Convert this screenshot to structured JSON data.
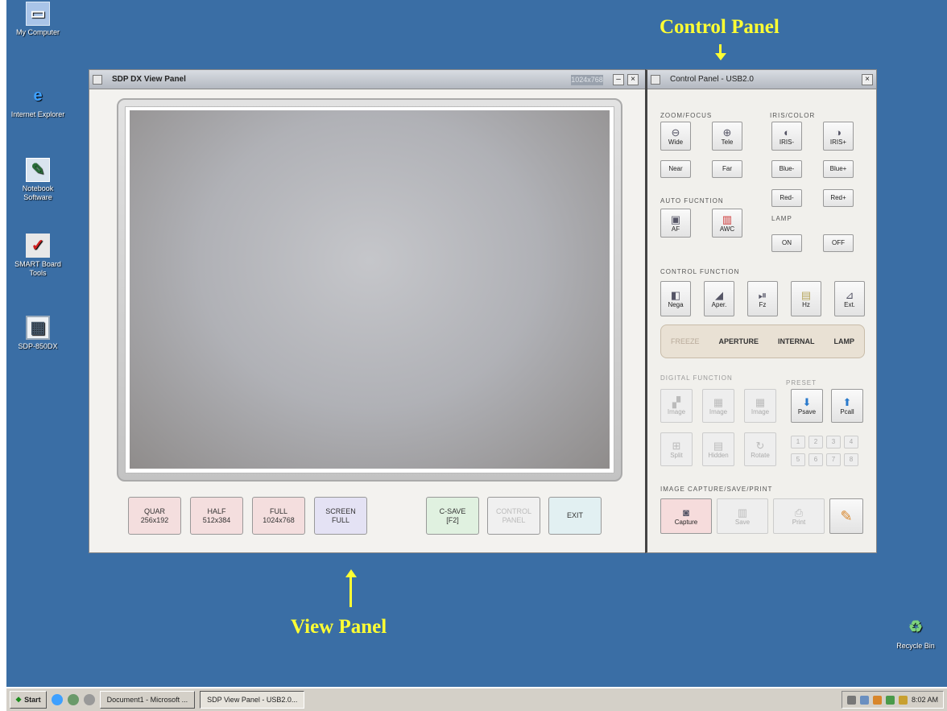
{
  "desktop": {
    "icons": [
      "My Computer",
      "Internet Explorer",
      "Notebook Software",
      "SMART Board Tools",
      "SDP-850DX",
      "Recycle Bin"
    ],
    "labels": {
      "control_panel": "Control Panel",
      "view_panel": "View Panel"
    }
  },
  "view_panel": {
    "title": "SDP DX View Panel",
    "resolution_badge": "1024x768",
    "buttons": {
      "quar": "QUAR\n256x192",
      "half": "HALF\n512x384",
      "full": "FULL\n1024x768",
      "screen_full": "SCREEN\nFULL",
      "csave": "C-SAVE\n[F2]",
      "control_panel": "CONTROL\nPANEL",
      "exit": "EXIT"
    }
  },
  "control_panel": {
    "title": "Control Panel - USB2.0",
    "sections": {
      "zoom_focus": "ZOOM/FOCUS",
      "iris_color": "IRIS/COLOR",
      "auto_function": "AUTO FUCNTION",
      "lamp": "LAMP",
      "control_function": "CONTROL FUNCTION",
      "digital_function": "DIGITAL FUNCTION",
      "preset": "PRESET",
      "image_capture": "IMAGE CAPTURE/SAVE/PRINT"
    },
    "buttons": {
      "wide": "Wide",
      "tele": "Tele",
      "near": "Near",
      "far": "Far",
      "iris_minus": "IRIS-",
      "iris_plus": "IRIS+",
      "blue_minus": "Blue-",
      "blue_plus": "Blue+",
      "red_minus": "Red-",
      "red_plus": "Red+",
      "af": "AF",
      "awc": "AWC",
      "on": "ON",
      "off": "OFF",
      "nega": "Nega",
      "aper": "Aper.",
      "fz": "Fz",
      "hz": "Hz",
      "ext": "Ext.",
      "digital_1": "Image",
      "digital_2": "Image",
      "digital_3": "Image",
      "digital_4": "Split",
      "digital_5": "Hidden",
      "digital_6": "Rotate",
      "psave": "Psave",
      "pcall": "Pcall",
      "capture": "Capture",
      "save": "Save",
      "print": "Print",
      "preset_slots": [
        "1",
        "2",
        "3",
        "4",
        "5",
        "6",
        "7",
        "8"
      ]
    },
    "status": {
      "freeze": "FREEZE",
      "aperture": "APERTURE",
      "internal": "INTERNAL",
      "lamp": "LAMP"
    }
  },
  "taskbar": {
    "start": "Start",
    "tasks": [
      "Document1 - Microsoft ...",
      "SDP View Panel - USB2.0..."
    ],
    "clock": "8:02 AM"
  }
}
